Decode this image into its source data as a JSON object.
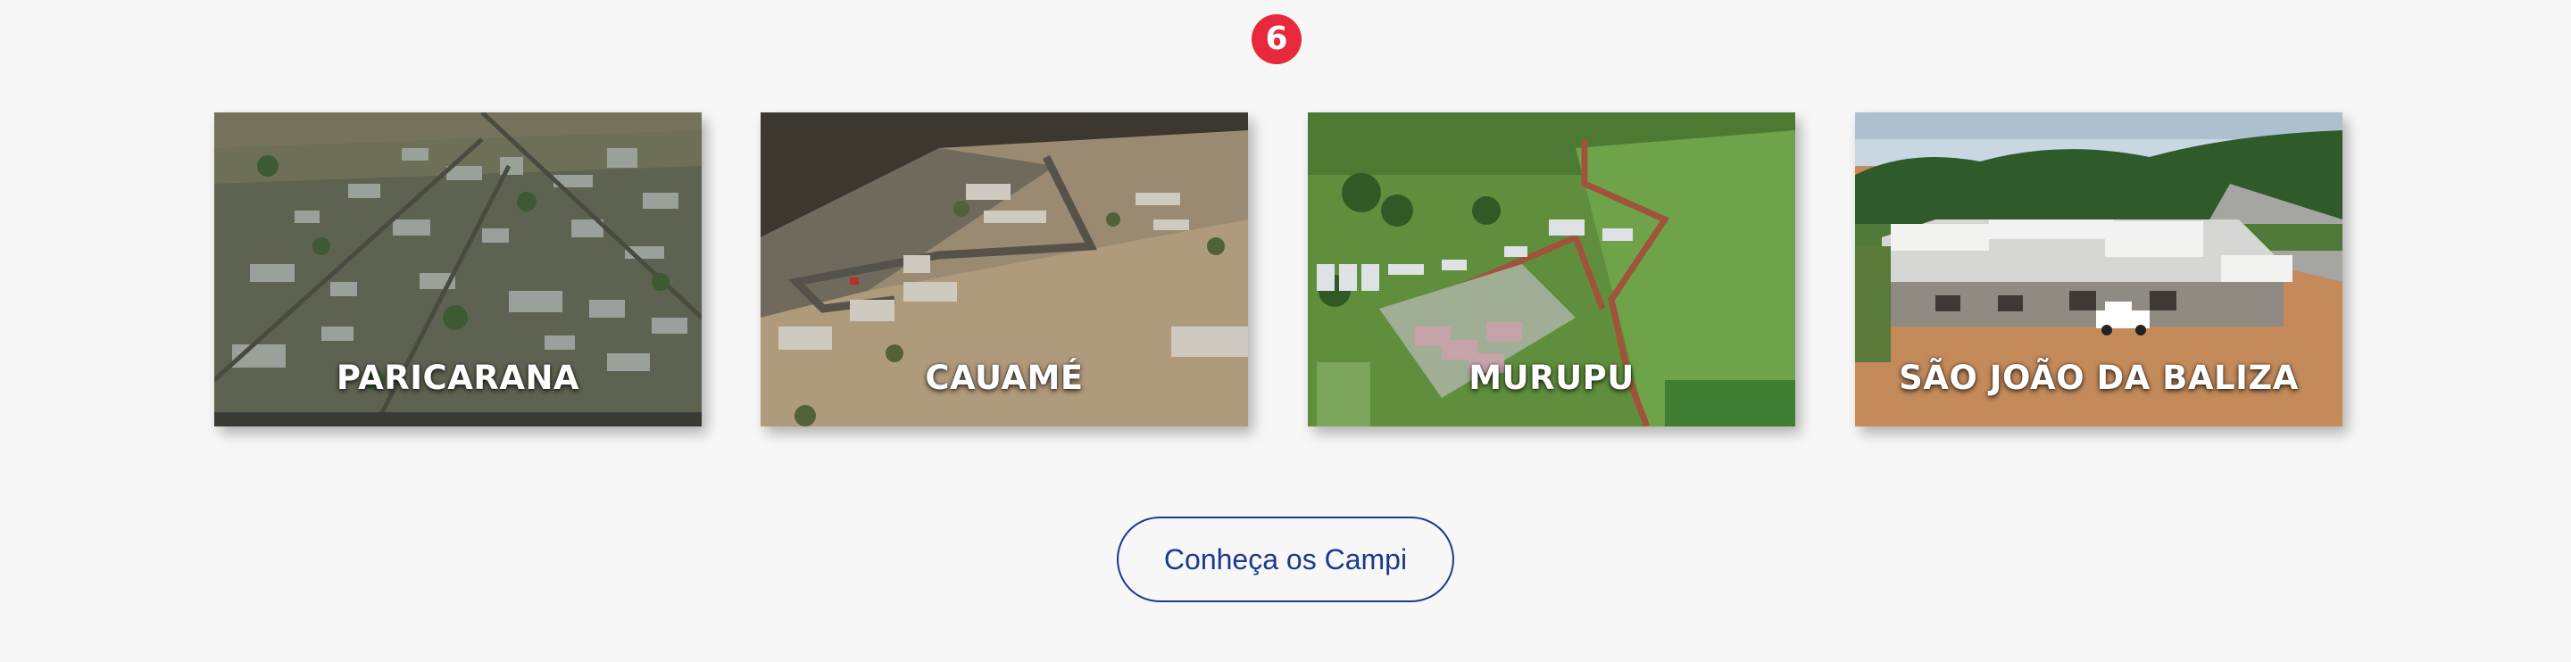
{
  "badge": {
    "number": "6",
    "color": "#e8293b"
  },
  "campuses": [
    {
      "name": "PARICARANA",
      "image": "aerial view of urban campus"
    },
    {
      "name": "CAUAMÉ",
      "image": "aerial view of campus with roads in dry field"
    },
    {
      "name": "MURUPU",
      "image": "aerial view of campus in green fields"
    },
    {
      "name": "SÃO JOÃO DA BALIZA",
      "image": "building with pickup truck on red soil"
    }
  ],
  "cta": {
    "label": "Conheça os Campi"
  },
  "colors": {
    "background": "#f7f7f7",
    "accent": "#1b3a8f",
    "badge": "#e8293b"
  }
}
